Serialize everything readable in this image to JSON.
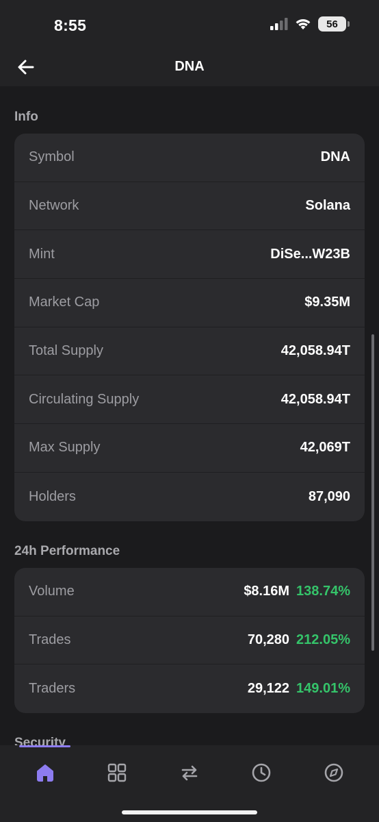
{
  "status_bar": {
    "time": "8:55",
    "battery": "56"
  },
  "header": {
    "title": "DNA"
  },
  "info": {
    "title": "Info",
    "rows": [
      {
        "label": "Symbol",
        "value": "DNA"
      },
      {
        "label": "Network",
        "value": "Solana"
      },
      {
        "label": "Mint",
        "value": "DiSe...W23B"
      },
      {
        "label": "Market Cap",
        "value": "$9.35M"
      },
      {
        "label": "Total Supply",
        "value": "42,058.94T"
      },
      {
        "label": "Circulating Supply",
        "value": "42,058.94T"
      },
      {
        "label": "Max Supply",
        "value": "42,069T"
      },
      {
        "label": "Holders",
        "value": "87,090"
      }
    ]
  },
  "performance": {
    "title": "24h Performance",
    "rows": [
      {
        "label": "Volume",
        "value": "$8.16M",
        "change": "138.74%"
      },
      {
        "label": "Trades",
        "value": "70,280",
        "change": "212.05%"
      },
      {
        "label": "Traders",
        "value": "29,122",
        "change": "149.01%"
      }
    ]
  },
  "security": {
    "title": "Security"
  },
  "tabs": [
    {
      "icon": "home-icon",
      "active": true
    },
    {
      "icon": "grid-icon",
      "active": false
    },
    {
      "icon": "swap-icon",
      "active": false
    },
    {
      "icon": "clock-icon",
      "active": false
    },
    {
      "icon": "compass-icon",
      "active": false
    }
  ],
  "colors": {
    "accent": "#8d7cf0",
    "positive": "#35c46a",
    "card": "#2b2b2e",
    "background": "#1b1b1d"
  }
}
